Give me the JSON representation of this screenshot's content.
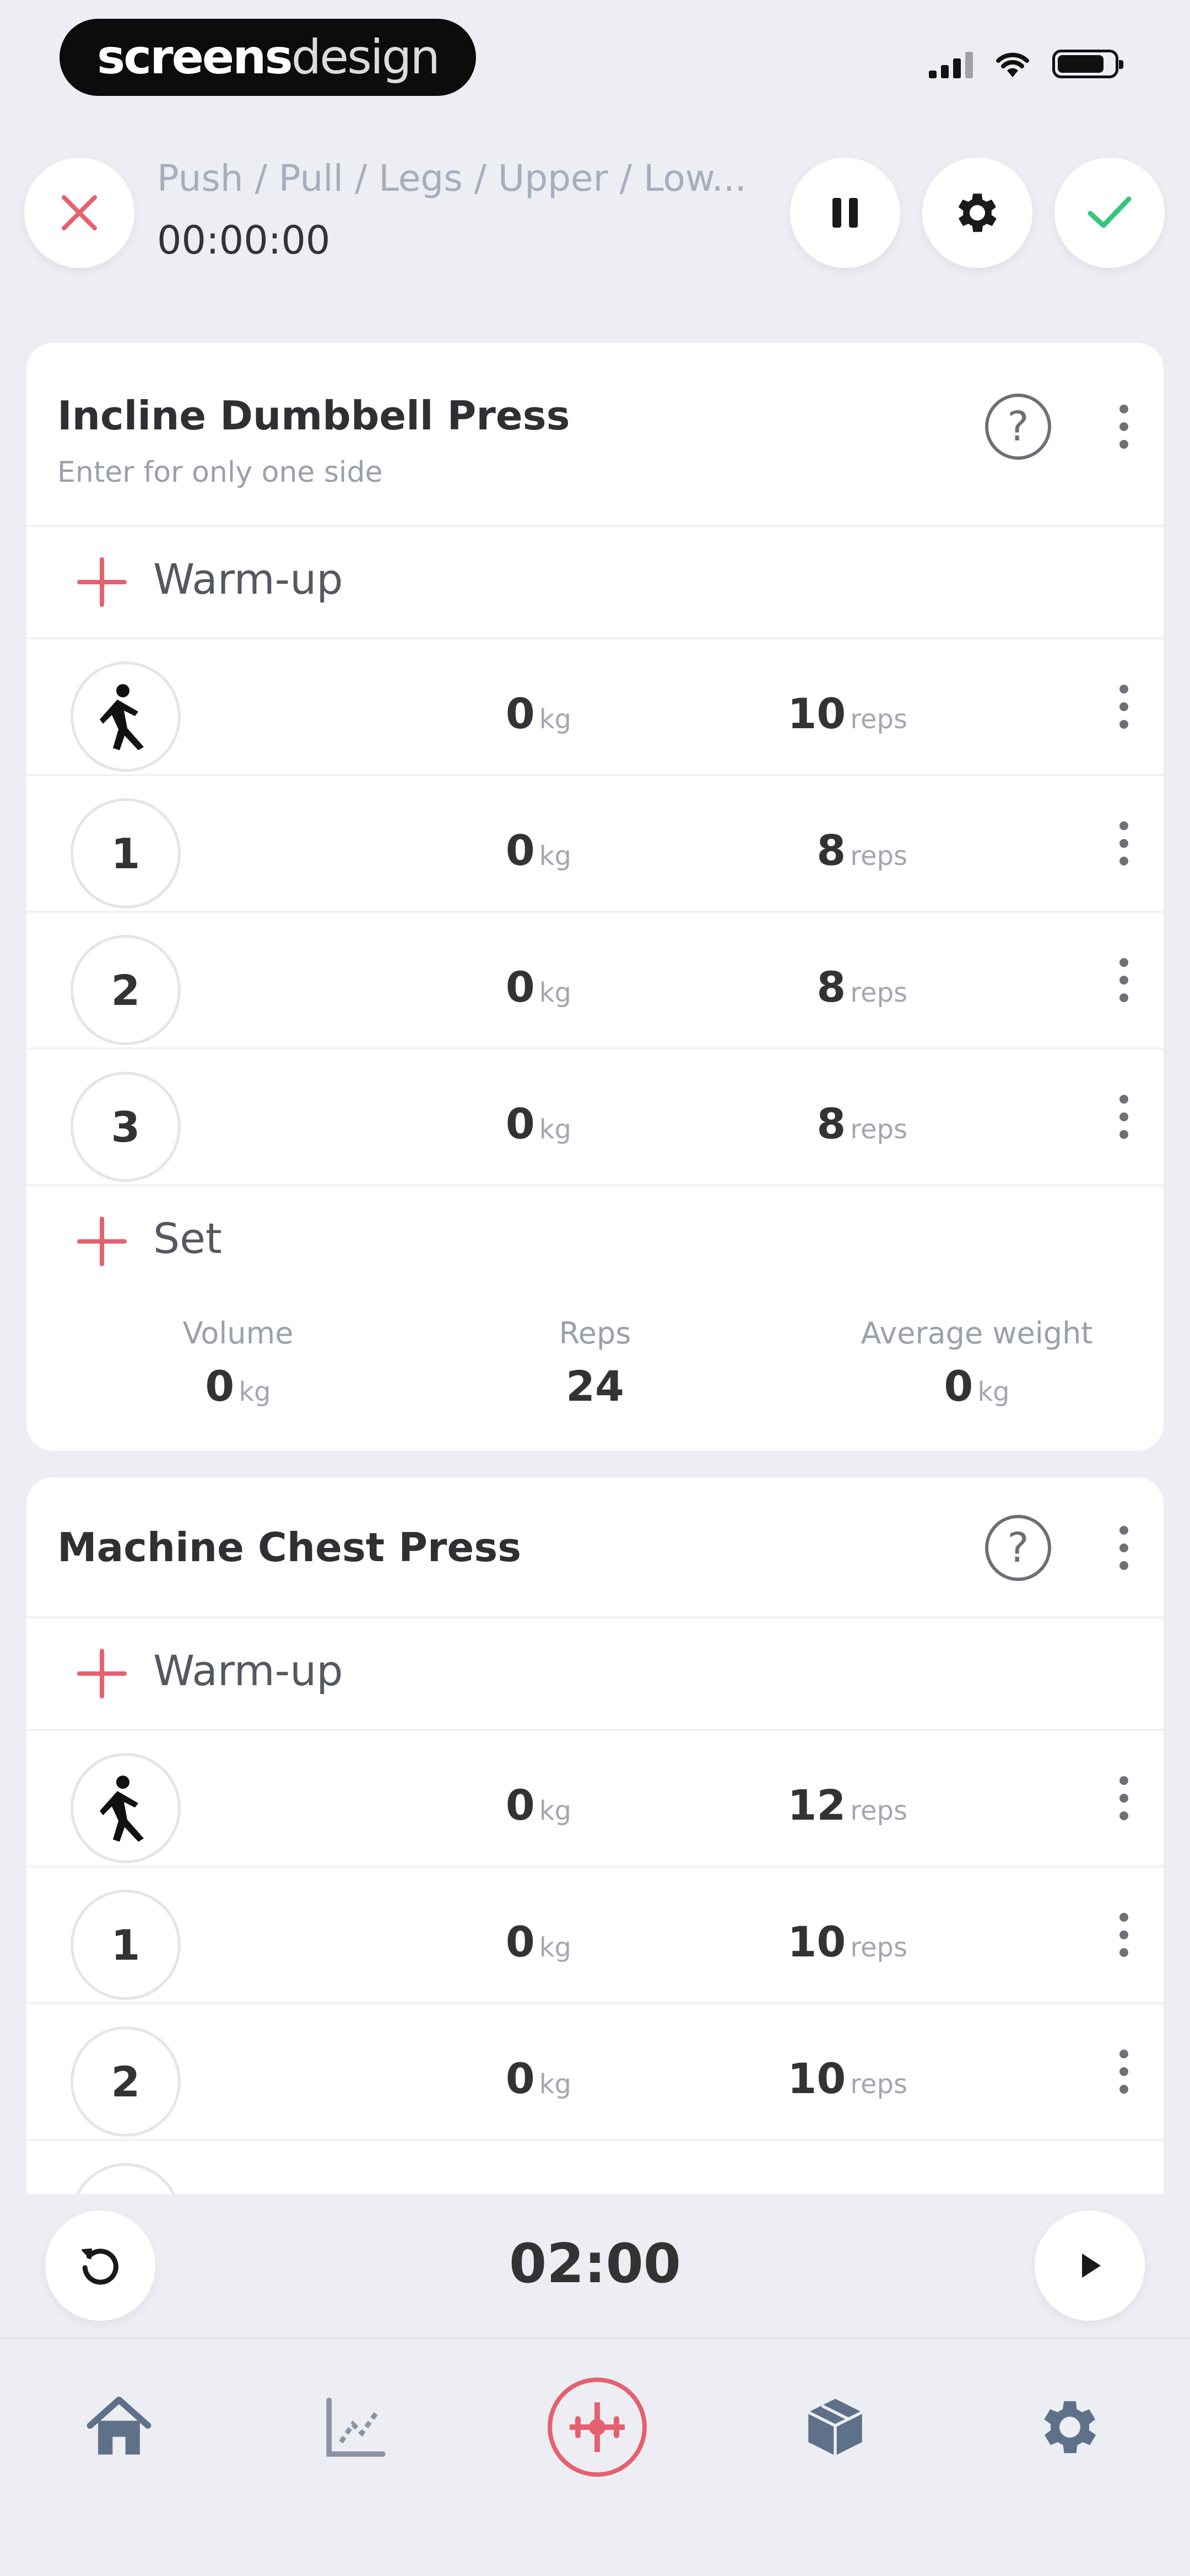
{
  "status_bar": {
    "brand_bold": "screens",
    "brand_light": "design"
  },
  "header": {
    "workout_title": "Push / Pull / Legs / Upper / Low...",
    "elapsed_time": "00:00:00",
    "icons": [
      "close-icon",
      "pause-icon",
      "gear-icon",
      "check-icon"
    ]
  },
  "exercises": [
    {
      "name": "Incline Dumbbell Press",
      "note": "Enter for only one side",
      "warmup_label": "Warm-up",
      "sets": [
        {
          "badge": "",
          "weight": "0",
          "reps": "10"
        },
        {
          "badge": "1",
          "weight": "0",
          "reps": "8"
        },
        {
          "badge": "2",
          "weight": "0",
          "reps": "8"
        },
        {
          "badge": "3",
          "weight": "0",
          "reps": "8"
        }
      ],
      "add_set_label": "Set",
      "stats": {
        "volume_label": "Volume",
        "volume_value": "0",
        "reps_label": "Reps",
        "reps_value": "24",
        "avg_label": "Average weight",
        "avg_value": "0"
      }
    },
    {
      "name": "Machine Chest Press",
      "warmup_label": "Warm-up",
      "sets": [
        {
          "badge": "",
          "weight": "0",
          "reps": "12"
        },
        {
          "badge": "1",
          "weight": "0",
          "reps": "10"
        },
        {
          "badge": "2",
          "weight": "0",
          "reps": "10"
        }
      ]
    }
  ],
  "units": {
    "weight": "kg",
    "reps": "reps"
  },
  "help_glyph": "?",
  "rest_timer": {
    "time": "02:00"
  },
  "tab_bar": {
    "tabs": [
      "home-icon",
      "chart-icon",
      "workout-icon",
      "box-icon",
      "gear-icon"
    ],
    "active_index": 2
  },
  "colors": {
    "accent": "#e56170",
    "success": "#35c77a",
    "background": "#eceef3"
  }
}
